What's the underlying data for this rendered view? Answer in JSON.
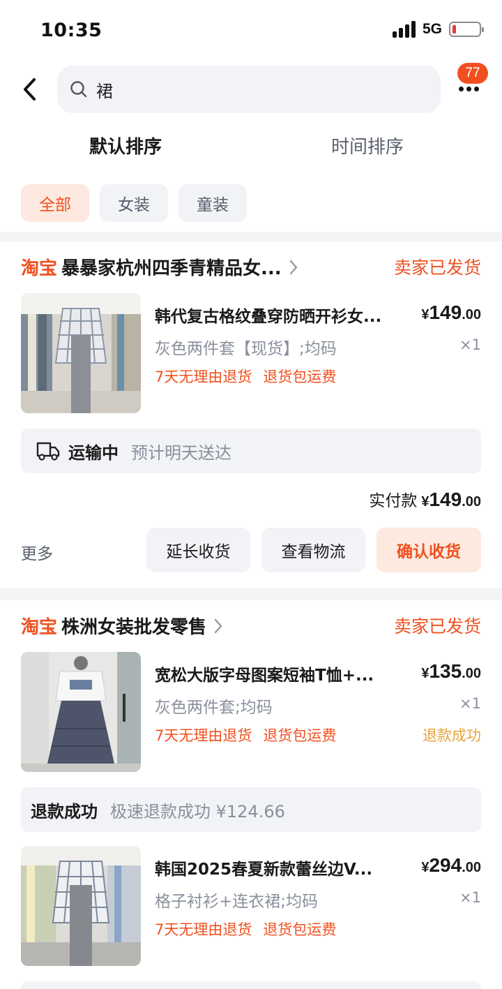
{
  "status_bar": {
    "time": "10:35",
    "network": "5G",
    "battery_percent": 15
  },
  "header": {
    "search_query": "裙",
    "badge_count": "77"
  },
  "sort_tabs": [
    {
      "label": "默认排序",
      "active": true
    },
    {
      "label": "时间排序",
      "active": false
    }
  ],
  "filters": [
    {
      "label": "全部",
      "active": true
    },
    {
      "label": "女装",
      "active": false
    },
    {
      "label": "童装",
      "active": false
    }
  ],
  "orders": [
    {
      "platform": "淘宝",
      "shop": "暴暴家杭州四季青精品女...",
      "status": "卖家已发货",
      "items": [
        {
          "title": "韩代复古格纹叠穿防晒开衫女...",
          "price_currency": "¥",
          "price_int": "149",
          "price_dec": ".00",
          "sku": "灰色两件套【现货】;均码",
          "qty": "×1",
          "services": [
            "7天无理由退货",
            "退货包运费"
          ]
        }
      ],
      "logistics": {
        "state": "运输中",
        "eta": "预计明天送达"
      },
      "paid_label": "实付款",
      "paid_currency": "¥",
      "paid_int": "149",
      "paid_dec": ".00",
      "more": "更多",
      "actions": {
        "extend": "延长收货",
        "track": "查看物流",
        "confirm": "确认收货"
      }
    },
    {
      "platform": "淘宝",
      "shop": "株洲女装批发零售",
      "status": "卖家已发货",
      "items": [
        {
          "title": "宽松大版字母图案短袖T恤+...",
          "price_currency": "¥",
          "price_int": "135",
          "price_dec": ".00",
          "sku": "灰色两件套;均码",
          "qty": "×1",
          "services": [
            "7天无理由退货",
            "退货包运费"
          ],
          "refund_tag": "退款成功"
        },
        {
          "title": "韩国2025春夏新款蕾丝边V...",
          "price_currency": "¥",
          "price_int": "294",
          "price_dec": ".00",
          "sku": "格子衬衫+连衣裙;均码",
          "qty": "×1",
          "services": [
            "7天无理由退货",
            "退货包运费"
          ]
        }
      ],
      "refund": {
        "label": "退款成功",
        "detail": "极速退款成功 ¥124.66"
      }
    }
  ],
  "colors": {
    "accent": "#f0501f",
    "refund": "#e8a33a",
    "muted": "#8a8f9c",
    "panel": "#f2f3f7"
  }
}
